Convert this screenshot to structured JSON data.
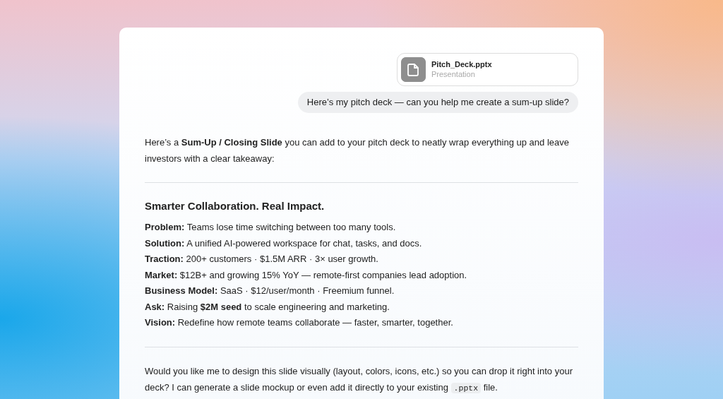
{
  "attachment": {
    "file_name": "Pitch_Deck.pptx",
    "file_type": "Presentation"
  },
  "user_message": "Here’s my pitch deck — can you help me create a sum-up slide?",
  "reply": {
    "intro": "Here’s a **Sum-Up / Closing Slide** you can add to your pitch deck to neatly wrap everything up and leave investors with a clear takeaway:",
    "slide_title": "Smarter Collaboration. Real Impact.",
    "points": [
      "**Problem:** Teams lose time switching between too many tools.",
      "**Solution:** A unified AI-powered workspace for chat, tasks, and docs.",
      "**Traction:** 200+ customers · $1.5M ARR · 3× user growth.",
      "**Market:** $12B+ and growing 15% YoY — remote-first companies lead adoption.",
      "**Business Model:** SaaS · $12/user/month · Freemium funnel.",
      "**Ask:** Raising **$2M seed** to scale engineering and marketing.",
      "**Vision:** Redefine how remote teams collaborate — faster, smarter, together."
    ],
    "closing": {
      "text_before": "Would you like me to design this slide visually (layout, colors, icons, etc.) so you can drop it right into your deck? I can generate a slide mockup or even add it directly to your existing ",
      "code": ".pptx",
      "text_after": " file."
    }
  }
}
